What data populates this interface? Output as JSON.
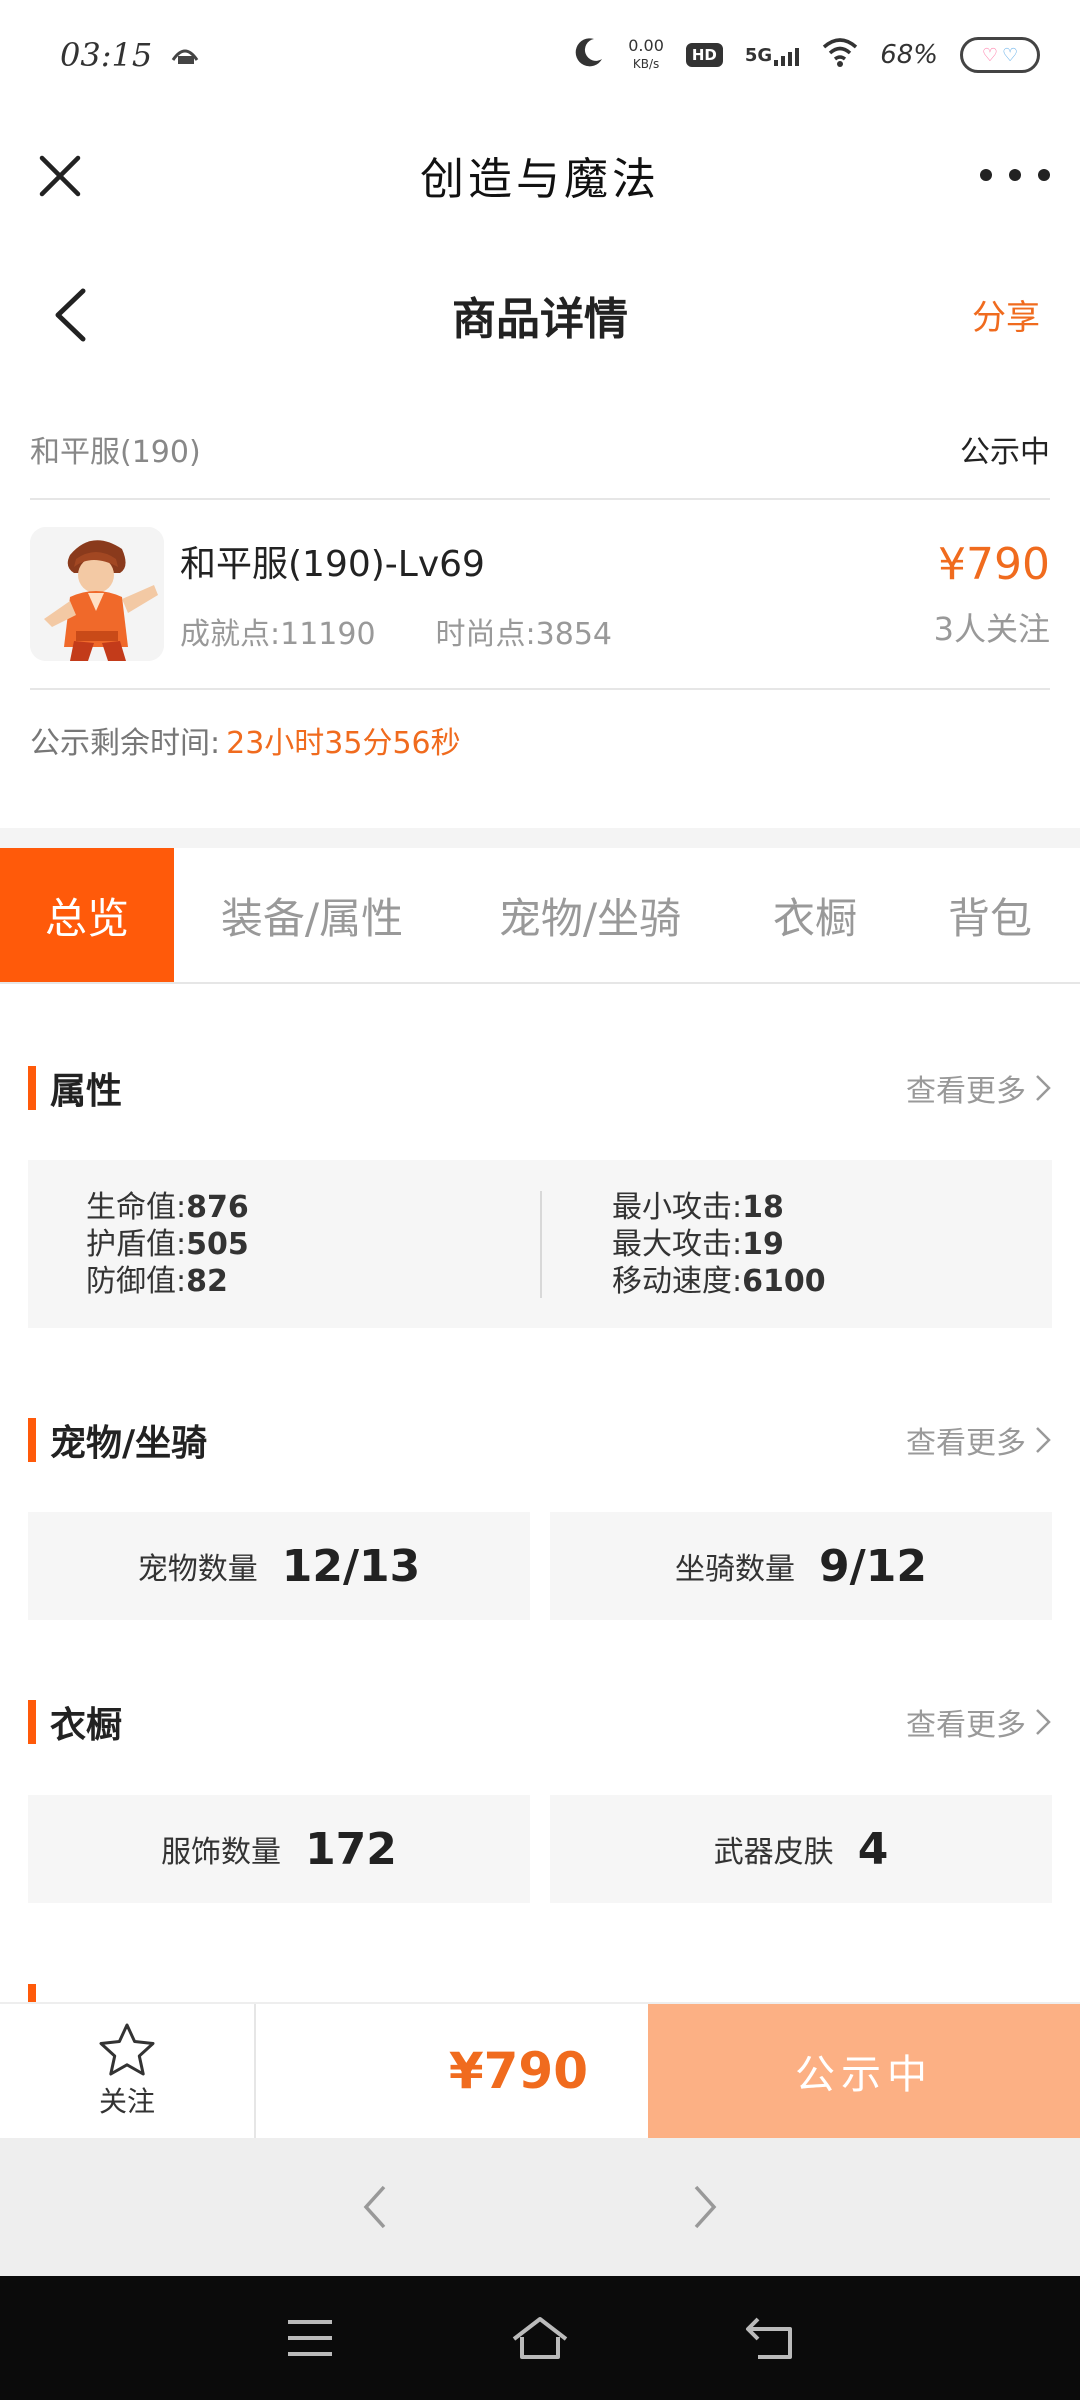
{
  "status_bar": {
    "time": "03:15",
    "net_speed": "0.00",
    "net_unit": "KB/s",
    "hd": "HD",
    "signal": "5G",
    "battery": "68%"
  },
  "app": {
    "title": "创造与魔法"
  },
  "header": {
    "title": "商品详情",
    "share": "分享"
  },
  "product": {
    "server": "和平服(190)",
    "status": "公示中",
    "name": "和平服(190)-Lv69",
    "achievement": "成就点:11190",
    "fashion": "时尚点:3854",
    "price": "¥790",
    "followers": "3人关注",
    "countdown_label": "公示剩余时间:",
    "countdown_value": "23小时35分56秒"
  },
  "tabs": [
    {
      "label": "总览"
    },
    {
      "label": "装备/属性"
    },
    {
      "label": "宠物/坐骑"
    },
    {
      "label": "衣橱"
    },
    {
      "label": "背包"
    }
  ],
  "sections": {
    "see_more": "查看更多",
    "attributes": {
      "title": "属性",
      "left": [
        {
          "label": "生命值:",
          "value": "876"
        },
        {
          "label": "护盾值:",
          "value": "505"
        },
        {
          "label": "防御值:",
          "value": "82"
        }
      ],
      "right": [
        {
          "label": "最小攻击:",
          "value": "18"
        },
        {
          "label": "最大攻击:",
          "value": "19"
        },
        {
          "label": "移动速度:",
          "value": "6100"
        }
      ]
    },
    "pets": {
      "title": "宠物/坐骑",
      "pet_label": "宠物数量",
      "pet_value": "12/13",
      "mount_label": "坐骑数量",
      "mount_value": "9/12"
    },
    "wardrobe": {
      "title": "衣橱",
      "outfit_label": "服饰数量",
      "outfit_value": "172",
      "skin_label": "武器皮肤",
      "skin_value": "4"
    }
  },
  "action_bar": {
    "follow": "关注",
    "price": "¥790",
    "buy": "公示中"
  }
}
